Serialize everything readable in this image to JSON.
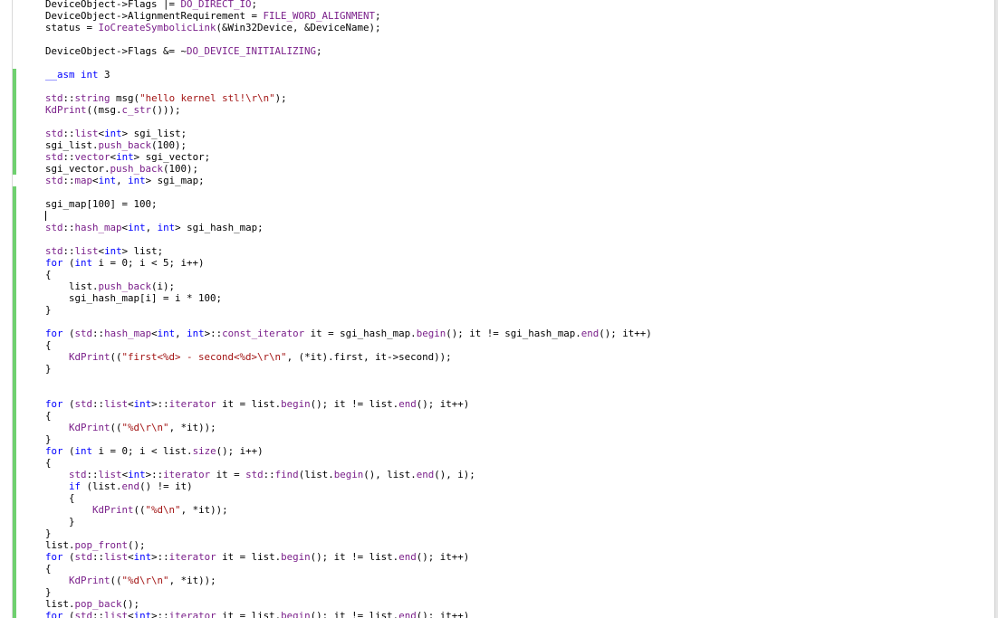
{
  "editor": {
    "lines": [
      [
        {
          "t": "DeviceObject->Flags |= ",
          "c": "txt"
        },
        {
          "t": "DO_DIRECT_IO",
          "c": "mac"
        },
        {
          "t": ";",
          "c": "txt"
        }
      ],
      [
        {
          "t": "DeviceObject->AlignmentRequirement = ",
          "c": "txt"
        },
        {
          "t": "FILE_WORD_ALIGNMENT",
          "c": "mac"
        },
        {
          "t": ";",
          "c": "txt"
        }
      ],
      [
        {
          "t": "status = ",
          "c": "txt"
        },
        {
          "t": "IoCreateSymbolicLink",
          "c": "fn"
        },
        {
          "t": "(&Win32Device, &DeviceName);",
          "c": "txt"
        }
      ],
      [],
      [
        {
          "t": "DeviceObject->Flags &= ~",
          "c": "txt"
        },
        {
          "t": "DO_DEVICE_INITIALIZING",
          "c": "mac"
        },
        {
          "t": ";",
          "c": "txt"
        }
      ],
      [],
      [
        {
          "t": "__asm int",
          "c": "kw"
        },
        {
          "t": " 3",
          "c": "txt"
        }
      ],
      [],
      [
        {
          "t": "std",
          "c": "ns"
        },
        {
          "t": "::",
          "c": "txt"
        },
        {
          "t": "string",
          "c": "ns"
        },
        {
          "t": " msg(",
          "c": "txt"
        },
        {
          "t": "\"hello kernel stl!\\r\\n\"",
          "c": "str"
        },
        {
          "t": ");",
          "c": "txt"
        }
      ],
      [
        {
          "t": "KdPrint",
          "c": "fn"
        },
        {
          "t": "((msg.",
          "c": "txt"
        },
        {
          "t": "c_str",
          "c": "fn"
        },
        {
          "t": "()));",
          "c": "txt"
        }
      ],
      [],
      [
        {
          "t": "std",
          "c": "ns"
        },
        {
          "t": "::",
          "c": "txt"
        },
        {
          "t": "list",
          "c": "ns"
        },
        {
          "t": "<",
          "c": "txt"
        },
        {
          "t": "int",
          "c": "kw"
        },
        {
          "t": "> sgi_list;",
          "c": "txt"
        }
      ],
      [
        {
          "t": "sgi_list.",
          "c": "txt"
        },
        {
          "t": "push_back",
          "c": "fn"
        },
        {
          "t": "(100);",
          "c": "txt"
        }
      ],
      [
        {
          "t": "std",
          "c": "ns"
        },
        {
          "t": "::",
          "c": "txt"
        },
        {
          "t": "vector",
          "c": "ns"
        },
        {
          "t": "<",
          "c": "txt"
        },
        {
          "t": "int",
          "c": "kw"
        },
        {
          "t": "> sgi_vector;",
          "c": "txt"
        }
      ],
      [
        {
          "t": "sgi_vector.",
          "c": "txt"
        },
        {
          "t": "push_back",
          "c": "fn"
        },
        {
          "t": "(100);",
          "c": "txt"
        }
      ],
      [
        {
          "t": "std",
          "c": "ns"
        },
        {
          "t": "::",
          "c": "txt"
        },
        {
          "t": "map",
          "c": "ns"
        },
        {
          "t": "<",
          "c": "txt"
        },
        {
          "t": "int",
          "c": "kw"
        },
        {
          "t": ", ",
          "c": "txt"
        },
        {
          "t": "int",
          "c": "kw"
        },
        {
          "t": "> sgi_map;",
          "c": "txt"
        }
      ],
      [],
      [
        {
          "t": "sgi_map[100] = 100;",
          "c": "txt"
        }
      ],
      [],
      [
        {
          "t": "std",
          "c": "ns"
        },
        {
          "t": "::",
          "c": "txt"
        },
        {
          "t": "hash_map",
          "c": "ns"
        },
        {
          "t": "<",
          "c": "txt"
        },
        {
          "t": "int",
          "c": "kw"
        },
        {
          "t": ", ",
          "c": "txt"
        },
        {
          "t": "int",
          "c": "kw"
        },
        {
          "t": "> sgi_hash_map;",
          "c": "txt"
        }
      ],
      [],
      [
        {
          "t": "std",
          "c": "ns"
        },
        {
          "t": "::",
          "c": "txt"
        },
        {
          "t": "list",
          "c": "ns"
        },
        {
          "t": "<",
          "c": "txt"
        },
        {
          "t": "int",
          "c": "kw"
        },
        {
          "t": "> list;",
          "c": "txt"
        }
      ],
      [
        {
          "t": "for",
          "c": "kw"
        },
        {
          "t": " (",
          "c": "txt"
        },
        {
          "t": "int",
          "c": "kw"
        },
        {
          "t": " i = 0; i < 5; i++)",
          "c": "txt"
        }
      ],
      [
        {
          "t": "{",
          "c": "txt"
        }
      ],
      [
        {
          "t": "    list.",
          "c": "txt"
        },
        {
          "t": "push_back",
          "c": "fn"
        },
        {
          "t": "(i);",
          "c": "txt"
        }
      ],
      [
        {
          "t": "    sgi_hash_map[i] = i * 100;",
          "c": "txt"
        }
      ],
      [
        {
          "t": "}",
          "c": "txt"
        }
      ],
      [],
      [
        {
          "t": "for",
          "c": "kw"
        },
        {
          "t": " (",
          "c": "txt"
        },
        {
          "t": "std",
          "c": "ns"
        },
        {
          "t": "::",
          "c": "txt"
        },
        {
          "t": "hash_map",
          "c": "ns"
        },
        {
          "t": "<",
          "c": "txt"
        },
        {
          "t": "int",
          "c": "kw"
        },
        {
          "t": ", ",
          "c": "txt"
        },
        {
          "t": "int",
          "c": "kw"
        },
        {
          "t": ">::",
          "c": "txt"
        },
        {
          "t": "const_iterator",
          "c": "ns"
        },
        {
          "t": " it = sgi_hash_map.",
          "c": "txt"
        },
        {
          "t": "begin",
          "c": "fn"
        },
        {
          "t": "(); it != sgi_hash_map.",
          "c": "txt"
        },
        {
          "t": "end",
          "c": "fn"
        },
        {
          "t": "(); it++)",
          "c": "txt"
        }
      ],
      [
        {
          "t": "{",
          "c": "txt"
        }
      ],
      [
        {
          "t": "    ",
          "c": "txt"
        },
        {
          "t": "KdPrint",
          "c": "fn"
        },
        {
          "t": "((",
          "c": "txt"
        },
        {
          "t": "\"first<%d> - second<%d>\\r\\n\"",
          "c": "str"
        },
        {
          "t": ", (*it).first, it->second));",
          "c": "txt"
        }
      ],
      [
        {
          "t": "}",
          "c": "txt"
        }
      ],
      [],
      [],
      [
        {
          "t": "for",
          "c": "kw"
        },
        {
          "t": " (",
          "c": "txt"
        },
        {
          "t": "std",
          "c": "ns"
        },
        {
          "t": "::",
          "c": "txt"
        },
        {
          "t": "list",
          "c": "ns"
        },
        {
          "t": "<",
          "c": "txt"
        },
        {
          "t": "int",
          "c": "kw"
        },
        {
          "t": ">::",
          "c": "txt"
        },
        {
          "t": "iterator",
          "c": "ns"
        },
        {
          "t": " it = list.",
          "c": "txt"
        },
        {
          "t": "begin",
          "c": "fn"
        },
        {
          "t": "(); it != list.",
          "c": "txt"
        },
        {
          "t": "end",
          "c": "fn"
        },
        {
          "t": "(); it++)",
          "c": "txt"
        }
      ],
      [
        {
          "t": "{",
          "c": "txt"
        }
      ],
      [
        {
          "t": "    ",
          "c": "txt"
        },
        {
          "t": "KdPrint",
          "c": "fn"
        },
        {
          "t": "((",
          "c": "txt"
        },
        {
          "t": "\"%d\\r\\n\"",
          "c": "str"
        },
        {
          "t": ", *it));",
          "c": "txt"
        }
      ],
      [
        {
          "t": "}",
          "c": "txt"
        }
      ],
      [
        {
          "t": "for",
          "c": "kw"
        },
        {
          "t": " (",
          "c": "txt"
        },
        {
          "t": "int",
          "c": "kw"
        },
        {
          "t": " i = 0; i < list.",
          "c": "txt"
        },
        {
          "t": "size",
          "c": "fn"
        },
        {
          "t": "(); i++)",
          "c": "txt"
        }
      ],
      [
        {
          "t": "{",
          "c": "txt"
        }
      ],
      [
        {
          "t": "    ",
          "c": "txt"
        },
        {
          "t": "std",
          "c": "ns"
        },
        {
          "t": "::",
          "c": "txt"
        },
        {
          "t": "list",
          "c": "ns"
        },
        {
          "t": "<",
          "c": "txt"
        },
        {
          "t": "int",
          "c": "kw"
        },
        {
          "t": ">::",
          "c": "txt"
        },
        {
          "t": "iterator",
          "c": "ns"
        },
        {
          "t": " it = ",
          "c": "txt"
        },
        {
          "t": "std",
          "c": "ns"
        },
        {
          "t": "::",
          "c": "txt"
        },
        {
          "t": "find",
          "c": "fn"
        },
        {
          "t": "(list.",
          "c": "txt"
        },
        {
          "t": "begin",
          "c": "fn"
        },
        {
          "t": "(), list.",
          "c": "txt"
        },
        {
          "t": "end",
          "c": "fn"
        },
        {
          "t": "(), i);",
          "c": "txt"
        }
      ],
      [
        {
          "t": "    ",
          "c": "txt"
        },
        {
          "t": "if",
          "c": "kw"
        },
        {
          "t": " (list.",
          "c": "txt"
        },
        {
          "t": "end",
          "c": "fn"
        },
        {
          "t": "() != it)",
          "c": "txt"
        }
      ],
      [
        {
          "t": "    {",
          "c": "txt"
        }
      ],
      [
        {
          "t": "        ",
          "c": "txt"
        },
        {
          "t": "KdPrint",
          "c": "fn"
        },
        {
          "t": "((",
          "c": "txt"
        },
        {
          "t": "\"%d\\n\"",
          "c": "str"
        },
        {
          "t": ", *it));",
          "c": "txt"
        }
      ],
      [
        {
          "t": "    }",
          "c": "txt"
        }
      ],
      [
        {
          "t": "}",
          "c": "txt"
        }
      ],
      [
        {
          "t": "list.",
          "c": "txt"
        },
        {
          "t": "pop_front",
          "c": "fn"
        },
        {
          "t": "();",
          "c": "txt"
        }
      ],
      [
        {
          "t": "for",
          "c": "kw"
        },
        {
          "t": " (",
          "c": "txt"
        },
        {
          "t": "std",
          "c": "ns"
        },
        {
          "t": "::",
          "c": "txt"
        },
        {
          "t": "list",
          "c": "ns"
        },
        {
          "t": "<",
          "c": "txt"
        },
        {
          "t": "int",
          "c": "kw"
        },
        {
          "t": ">::",
          "c": "txt"
        },
        {
          "t": "iterator",
          "c": "ns"
        },
        {
          "t": " it = list.",
          "c": "txt"
        },
        {
          "t": "begin",
          "c": "fn"
        },
        {
          "t": "(); it != list.",
          "c": "txt"
        },
        {
          "t": "end",
          "c": "fn"
        },
        {
          "t": "(); it++)",
          "c": "txt"
        }
      ],
      [
        {
          "t": "{",
          "c": "txt"
        }
      ],
      [
        {
          "t": "    ",
          "c": "txt"
        },
        {
          "t": "KdPrint",
          "c": "fn"
        },
        {
          "t": "((",
          "c": "txt"
        },
        {
          "t": "\"%d\\r\\n\"",
          "c": "str"
        },
        {
          "t": ", *it));",
          "c": "txt"
        }
      ],
      [
        {
          "t": "}",
          "c": "txt"
        }
      ],
      [
        {
          "t": "list.",
          "c": "txt"
        },
        {
          "t": "pop_back",
          "c": "fn"
        },
        {
          "t": "();",
          "c": "txt"
        }
      ],
      [
        {
          "t": "for",
          "c": "kw"
        },
        {
          "t": " (",
          "c": "txt"
        },
        {
          "t": "std",
          "c": "ns"
        },
        {
          "t": "::",
          "c": "txt"
        },
        {
          "t": "list",
          "c": "ns"
        },
        {
          "t": "<",
          "c": "txt"
        },
        {
          "t": "int",
          "c": "kw"
        },
        {
          "t": ">::",
          "c": "txt"
        },
        {
          "t": "iterator",
          "c": "ns"
        },
        {
          "t": " it = list.",
          "c": "txt"
        },
        {
          "t": "begin",
          "c": "fn"
        },
        {
          "t": "(); it != list.",
          "c": "txt"
        },
        {
          "t": "end",
          "c": "fn"
        },
        {
          "t": "(); it++)",
          "c": "txt"
        }
      ]
    ],
    "changed_line_ranges": [
      [
        6,
        14
      ],
      [
        16,
        52
      ]
    ],
    "cursor_line": 18,
    "colors": {
      "keyword": "#0000ff",
      "identifier_purple": "#7a1f8a",
      "string": "#a31515",
      "text": "#000000",
      "change_bar": "#6fd06f",
      "background": "#ffffff"
    }
  }
}
